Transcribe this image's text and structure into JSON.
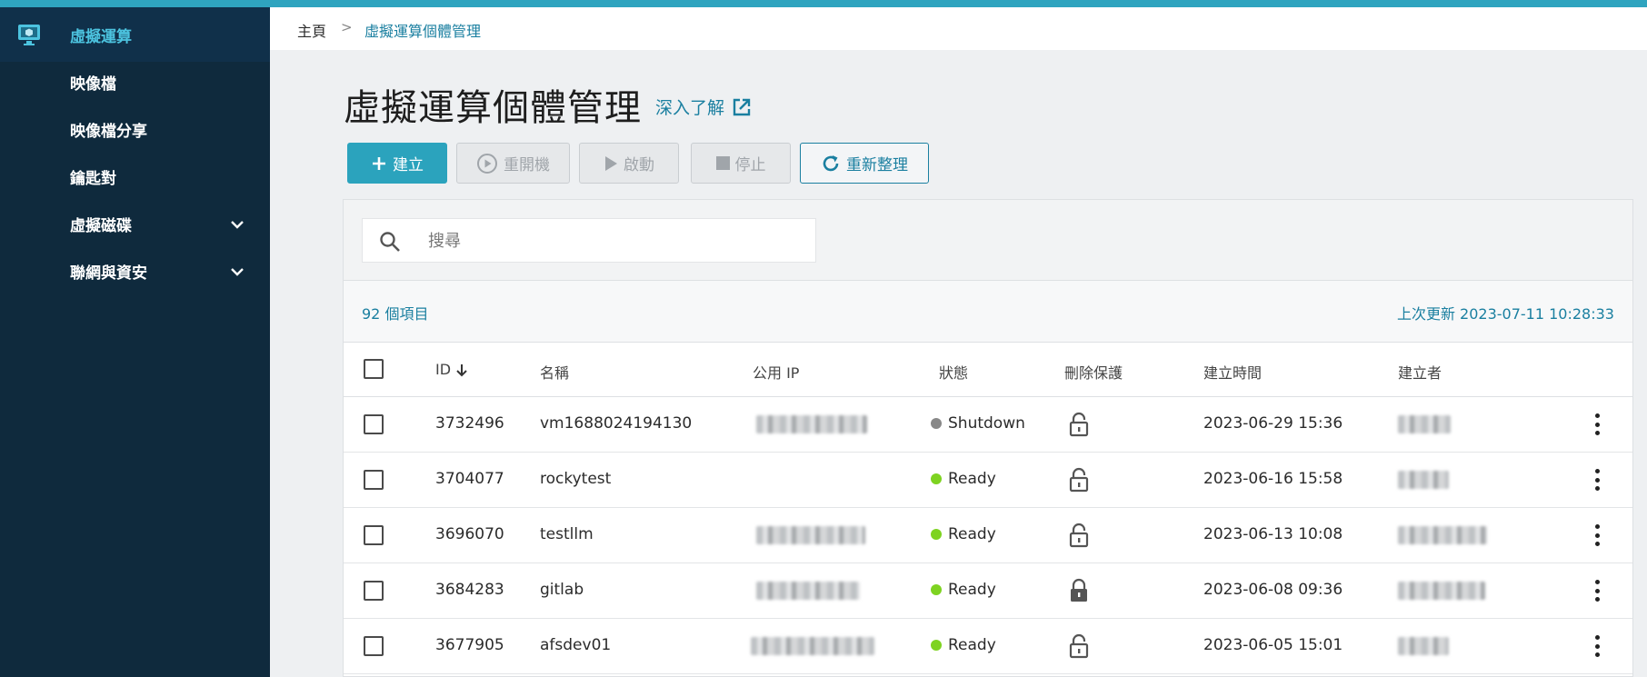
{
  "sidebar": {
    "items": [
      {
        "label": "虛擬運算",
        "icon": "monitor-icon",
        "active": true
      },
      {
        "label": "映像檔"
      },
      {
        "label": "映像檔分享"
      },
      {
        "label": "鑰匙對"
      },
      {
        "label": "虛擬磁碟",
        "expandable": true
      },
      {
        "label": "聯網與資安",
        "expandable": true
      }
    ]
  },
  "breadcrumb": {
    "home": "主頁",
    "separator": ">",
    "current": "虛擬運算個體管理"
  },
  "page": {
    "title": "虛擬運算個體管理",
    "learn_more": "深入了解"
  },
  "toolbar": {
    "create": "建立",
    "reboot": "重開機",
    "start": "啟動",
    "stop": "停止",
    "refresh": "重新整理"
  },
  "search": {
    "placeholder": "搜尋"
  },
  "summary": {
    "count": "92 個項目",
    "last_updated": "上次更新 2023-07-11 10:28:33"
  },
  "table": {
    "headers": {
      "id": "ID",
      "name": "名稱",
      "public_ip": "公用 IP",
      "status": "狀態",
      "delete_protection": "刪除保護",
      "created_at": "建立時間",
      "creator": "建立者"
    },
    "rows": [
      {
        "id": "3732496",
        "name": "vm1688024194130",
        "status": "Shutdown",
        "created_at": "2023-06-29 15:36",
        "locked": false
      },
      {
        "id": "3704077",
        "name": "rockytest",
        "status": "Ready",
        "created_at": "2023-06-16 15:58",
        "locked": false
      },
      {
        "id": "3696070",
        "name": "testllm",
        "status": "Ready",
        "created_at": "2023-06-13 10:08",
        "locked": false
      },
      {
        "id": "3684283",
        "name": "gitlab",
        "status": "Ready",
        "created_at": "2023-06-08 09:36",
        "locked": true
      },
      {
        "id": "3677905",
        "name": "afsdev01",
        "status": "Ready",
        "created_at": "2023-06-05 15:01",
        "locked": false
      }
    ]
  },
  "colors": {
    "accent": "#2ba3bd",
    "sidebar_bg": "#0f2a3d",
    "status_ready": "#7ed321",
    "status_shutdown": "#888888"
  }
}
